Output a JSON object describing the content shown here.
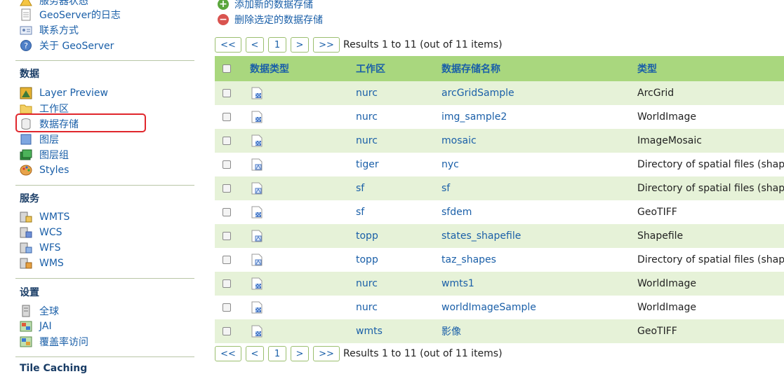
{
  "sidebar": {
    "top_items": [
      {
        "label": "服务器状态"
      },
      {
        "label": "GeoServer的日志"
      },
      {
        "label": "联系方式"
      },
      {
        "label": "关于 GeoServer"
      }
    ],
    "data_section": {
      "title": "数据",
      "items": [
        {
          "label": "Layer Preview"
        },
        {
          "label": "工作区"
        },
        {
          "label": "数据存储"
        },
        {
          "label": "图层"
        },
        {
          "label": "图层组"
        },
        {
          "label": "Styles"
        }
      ]
    },
    "services_section": {
      "title": "服务",
      "items": [
        {
          "label": "WMTS"
        },
        {
          "label": "WCS"
        },
        {
          "label": "WFS"
        },
        {
          "label": "WMS"
        }
      ]
    },
    "settings_section": {
      "title": "设置",
      "items": [
        {
          "label": "全球"
        },
        {
          "label": "JAI"
        },
        {
          "label": "覆盖率访问"
        }
      ]
    },
    "next_section_partial": "Tile Caching"
  },
  "actions": {
    "add": "添加新的数据存储",
    "remove": "删除选定的数据存储"
  },
  "pager": {
    "first": "<<",
    "prev": "<",
    "page": "1",
    "next": ">",
    "last": ">>",
    "summary": "Results 1 to 11 (out of 11 items)"
  },
  "table": {
    "headers": {
      "data_type": "数据类型",
      "workspace": "工作区",
      "store_name": "数据存储名称",
      "type": "类型"
    },
    "rows": [
      {
        "workspace": "nurc",
        "name": "arcGridSample",
        "type": "ArcGrid",
        "kind": "raster"
      },
      {
        "workspace": "nurc",
        "name": "img_sample2",
        "type": "WorldImage",
        "kind": "raster"
      },
      {
        "workspace": "nurc",
        "name": "mosaic",
        "type": "ImageMosaic",
        "kind": "raster"
      },
      {
        "workspace": "tiger",
        "name": "nyc",
        "type": "Directory of spatial files (shapefiles)",
        "kind": "vector"
      },
      {
        "workspace": "sf",
        "name": "sf",
        "type": "Directory of spatial files (shapefiles)",
        "kind": "vector"
      },
      {
        "workspace": "sf",
        "name": "sfdem",
        "type": "GeoTIFF",
        "kind": "raster"
      },
      {
        "workspace": "topp",
        "name": "states_shapefile",
        "type": "Shapefile",
        "kind": "vector"
      },
      {
        "workspace": "topp",
        "name": "taz_shapes",
        "type": "Directory of spatial files (shapefiles)",
        "kind": "vector"
      },
      {
        "workspace": "nurc",
        "name": "wmts1",
        "type": "WorldImage",
        "kind": "raster"
      },
      {
        "workspace": "nurc",
        "name": "worldImageSample",
        "type": "WorldImage",
        "kind": "raster"
      },
      {
        "workspace": "wmts",
        "name": "影像",
        "type": "GeoTIFF",
        "kind": "raster"
      }
    ]
  },
  "colors": {
    "accent": "#1a5fa8",
    "header_bg": "#a9d77e",
    "row_alt": "#e6f2d8",
    "highlight": "#e0262c",
    "add_icon": "#5aa63b",
    "remove_icon": "#d9534f"
  }
}
